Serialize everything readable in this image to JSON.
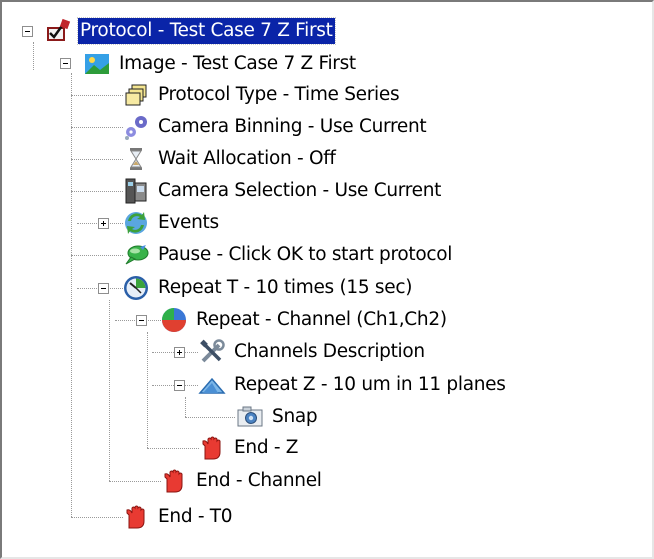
{
  "tree": {
    "root": {
      "label": "Protocol - Test Case 7 Z First",
      "icon": "protocol-icon",
      "expanded": true,
      "selected": true
    },
    "image": {
      "label": "Image - Test Case 7 Z First",
      "icon": "image-icon",
      "expanded": true
    },
    "protocol_type": {
      "label": "Protocol Type - Time Series",
      "icon": "stack-icon"
    },
    "camera_binning": {
      "label": "Camera Binning - Use Current",
      "icon": "gears-icon"
    },
    "wait_allocation": {
      "label": "Wait Allocation - Off",
      "icon": "hourglass-icon"
    },
    "camera_selection": {
      "label": "Camera Selection - Use Current",
      "icon": "camera-selection-icon"
    },
    "events": {
      "label": "Events",
      "icon": "events-icon",
      "expanded": false
    },
    "pause": {
      "label": "Pause - Click OK to start protocol",
      "icon": "speech-bubble-icon"
    },
    "repeat_t": {
      "label": "Repeat T - 10 times (15 sec)",
      "icon": "clock-icon",
      "expanded": true
    },
    "repeat_channel": {
      "label": "Repeat - Channel (Ch1,Ch2)",
      "icon": "color-wheel-icon",
      "expanded": true
    },
    "channels_description": {
      "label": "Channels Description",
      "icon": "tools-icon",
      "expanded": false
    },
    "repeat_z": {
      "label": "Repeat Z - 10 um in 11 planes",
      "icon": "triangle-icon",
      "expanded": true
    },
    "snap": {
      "label": "Snap",
      "icon": "camera-icon"
    },
    "end_z": {
      "label": "End - Z",
      "icon": "hand-icon"
    },
    "end_channel": {
      "label": "End - Channel",
      "icon": "hand-icon"
    },
    "end_t": {
      "label": "End - T0",
      "icon": "hand-icon"
    }
  }
}
